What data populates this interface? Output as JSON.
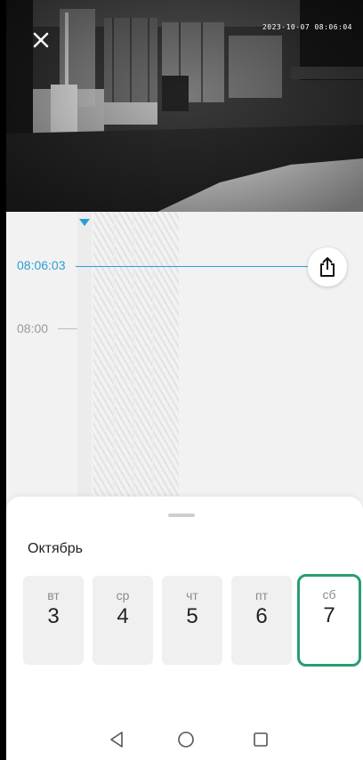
{
  "camera": {
    "timestamp": "2023-10-07 08:06:04",
    "close_icon": "close-icon"
  },
  "timeline": {
    "current_time": "08:06:03",
    "tick_label": "08:00",
    "marker_color": "#2a9fd6",
    "share_icon": "share-icon"
  },
  "calendar": {
    "month": "Октябрь",
    "days": [
      {
        "weekday": "вт",
        "date": "3"
      },
      {
        "weekday": "ср",
        "date": "4"
      },
      {
        "weekday": "чт",
        "date": "5"
      },
      {
        "weekday": "пт",
        "date": "6"
      },
      {
        "weekday": "сб",
        "date": "7"
      }
    ],
    "selected_date": "7",
    "selected_color": "#2a9d6e"
  },
  "system_nav": {
    "icons": [
      "back-icon",
      "home-icon",
      "recents-icon"
    ]
  }
}
